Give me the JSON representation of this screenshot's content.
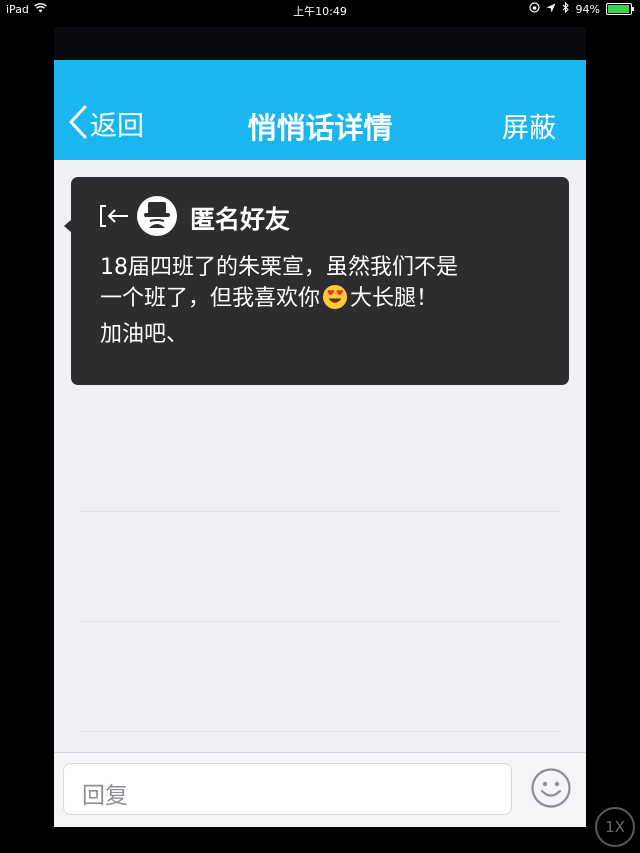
{
  "status_bar": {
    "device": "iPad",
    "time": "上午10:49",
    "battery_percent": "94%",
    "battery_level": 0.94,
    "battery_color": "#3fd14a"
  },
  "nav": {
    "back_label": "返回",
    "title": "悄悄话详情",
    "right_label": "屏蔽",
    "bar_color": "#1bb6f0"
  },
  "message": {
    "sender": "匿名好友",
    "lines": [
      "18届四班了的朱栗宣，虽然我们不是",
      "一个班了，但我喜欢你",
      "大长腿！",
      "加油吧、"
    ],
    "emoji": "heart-eyes-emoji-icon"
  },
  "input": {
    "placeholder": "回复"
  },
  "zoom_label": "1X"
}
